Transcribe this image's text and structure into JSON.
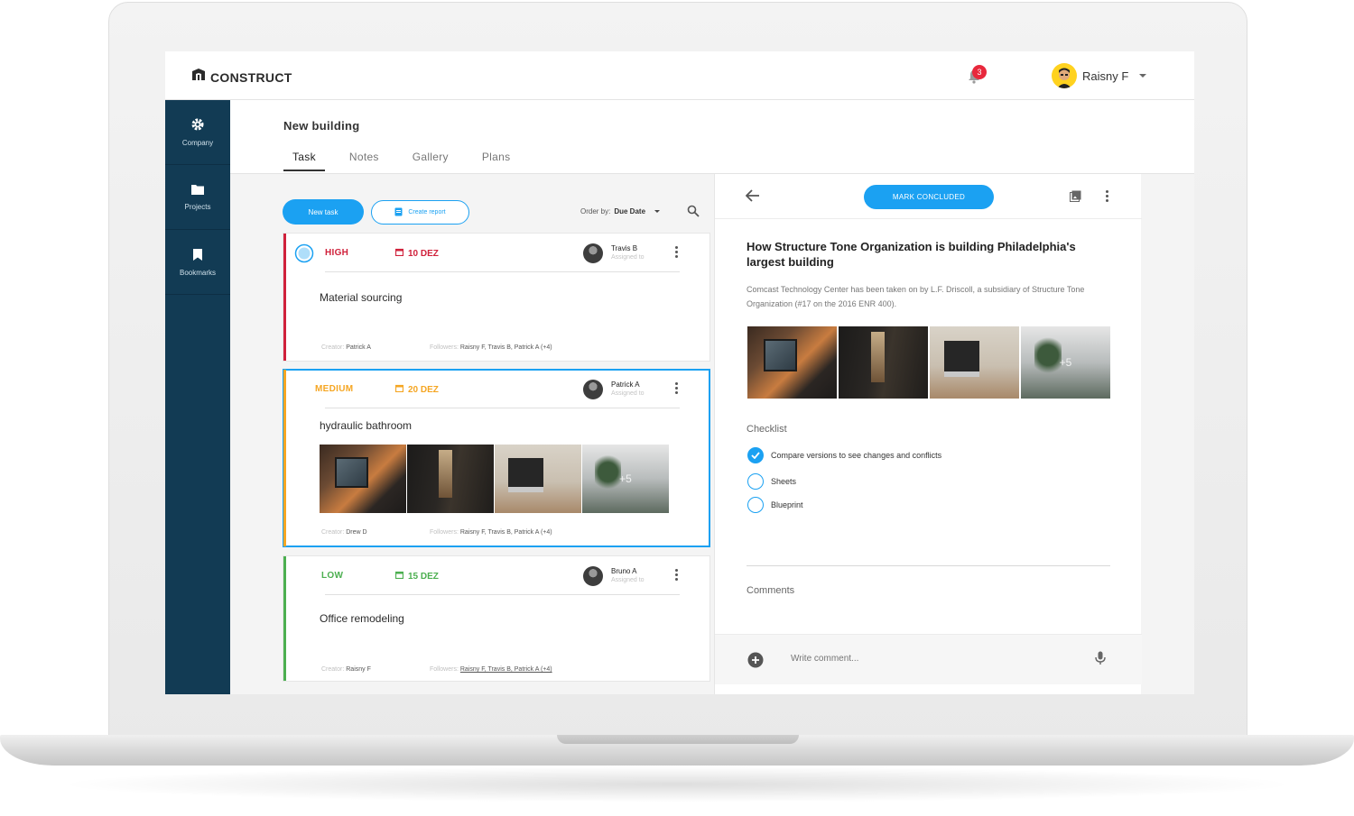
{
  "app": {
    "brand": "CONSTRUCT"
  },
  "header": {
    "notifications_count": "3",
    "user_name": "Raisny F"
  },
  "sidebar": {
    "items": [
      {
        "label": "Company",
        "icon": "gear-icon"
      },
      {
        "label": "Projects",
        "icon": "folder-icon"
      },
      {
        "label": "Bookmarks",
        "icon": "bookmark-icon"
      }
    ]
  },
  "page": {
    "title": "New building",
    "tabs": [
      {
        "label": "Task",
        "active": true
      },
      {
        "label": "Notes",
        "active": false
      },
      {
        "label": "Gallery",
        "active": false
      },
      {
        "label": "Plans",
        "active": false
      }
    ]
  },
  "toolbar": {
    "new_task": "New task",
    "create_report": "Create report",
    "order_label": "Order by:",
    "order_value": "Due Date"
  },
  "tasks": [
    {
      "priority": "HIGH",
      "priority_color": "#d0213b",
      "date": "10 DEZ",
      "assignee": "Travis B",
      "assignee_sub": "Assigned to",
      "title": "Material sourcing",
      "creator_label": "Creator:",
      "creator": "Patrick A",
      "followers_label": "Followers:",
      "followers": "Raisny F, Travis B, Patrick A (+4)"
    },
    {
      "priority": "MEDIUM",
      "priority_color": "#f5a623",
      "date": "20 DEZ",
      "assignee": "Patrick A",
      "assignee_sub": "Assigned to",
      "title": "hydraulic bathroom",
      "images_more": "+5",
      "creator_label": "Creator:",
      "creator": "Drew D",
      "followers_label": "Followers:",
      "followers": "Raisny F, Travis B, Patrick A (+4)"
    },
    {
      "priority": "LOW",
      "priority_color": "#4caf50",
      "date": "15 DEZ",
      "assignee": "Bruno A",
      "assignee_sub": "Assigned to",
      "title": "Office remodeling",
      "creator_label": "Creator:",
      "creator": "Raisny F",
      "followers_label": "Followers:",
      "followers": "Raisny F, Travis B, Patrick A (+4)"
    }
  ],
  "detail": {
    "mark_button": "MARK CONCLUDED",
    "title": "How Structure Tone Organization is building Philadelphia's largest building",
    "description": "Comcast Technology Center has been taken on by L.F. Driscoll, a subsidiary of Structure Tone Organization (#17 on the 2016 ENR 400).",
    "images_more": "+5",
    "checklist_heading": "Checklist",
    "checklist": [
      {
        "label": "Compare versions to see changes and conflicts",
        "checked": true
      },
      {
        "label": "Sheets",
        "checked": false
      },
      {
        "label": "Blueprint",
        "checked": false
      }
    ],
    "comments_heading": "Comments",
    "comment_placeholder": "Write comment..."
  },
  "colors": {
    "accent": "#1ba1f2",
    "sidebar": "#123b54",
    "high": "#d0213b",
    "medium": "#f5a623",
    "low": "#4caf50"
  }
}
